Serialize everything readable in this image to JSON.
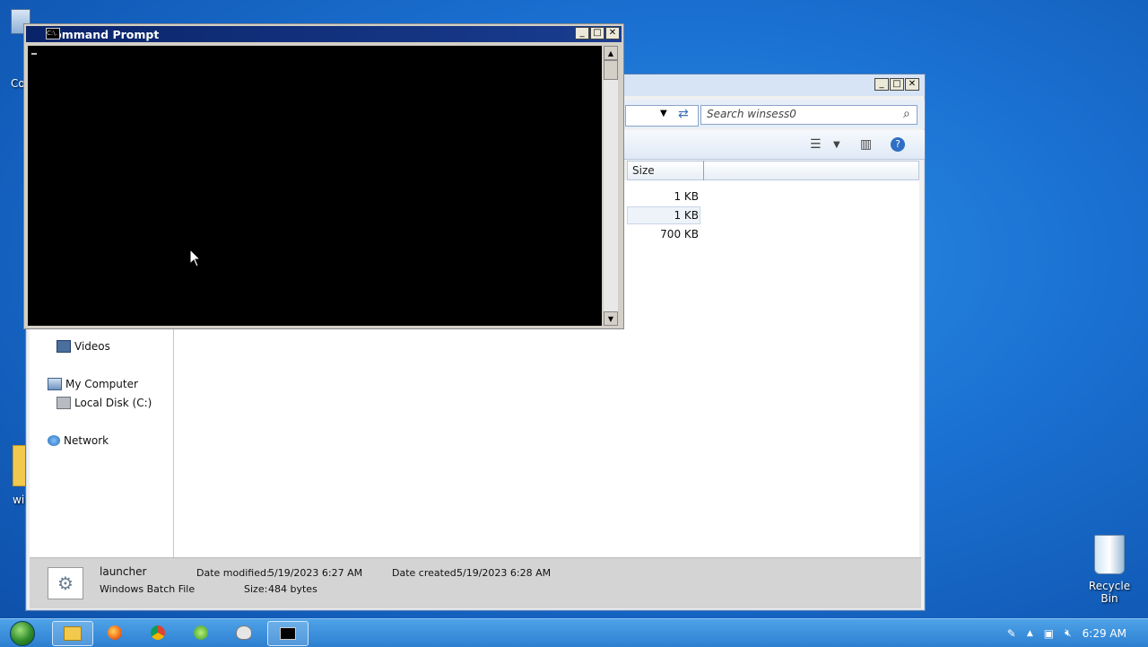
{
  "desktop": {
    "left_icon_label_1": "Co",
    "left_icon_label_2": "wi",
    "recycle_bin": "Recycle Bin"
  },
  "explorer": {
    "search_placeholder": "Search winsess0",
    "columns": {
      "size": "Size"
    },
    "rows": [
      {
        "size": "1 KB"
      },
      {
        "size": "1 KB"
      },
      {
        "size": "700 KB"
      }
    ],
    "nav": {
      "videos": "Videos",
      "my_computer": "My Computer",
      "local_disk": "Local Disk (C:)",
      "network": "Network"
    },
    "details": {
      "name": "launcher",
      "type": "Windows Batch File",
      "modified_label": "Date modified:",
      "modified_value": "5/19/2023 6:27 AM",
      "size_label": "Size:",
      "size_value": "484 bytes",
      "created_label": "Date created:",
      "created_value": "5/19/2023 6:28 AM"
    }
  },
  "cmd": {
    "title": "Command Prompt",
    "icon_text": "C:\\."
  },
  "taskbar": {
    "clock": "6:29 AM"
  }
}
